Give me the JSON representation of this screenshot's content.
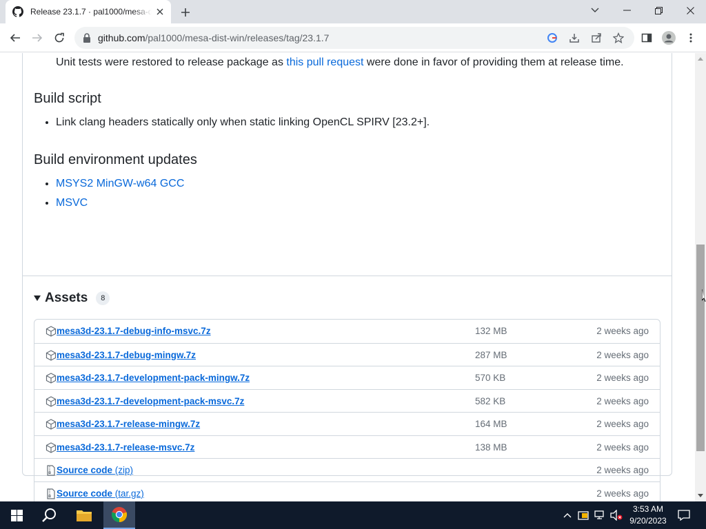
{
  "browser": {
    "tab_title": "Release 23.1.7 · pal1000/mesa-dist-win",
    "url_host": "github.com",
    "url_path": "/pal1000/mesa-dist-win/releases/tag/23.1.7"
  },
  "page": {
    "cutoff_text_before": "Unit tests were restored to release package as",
    "cutoff_link": "this pull request",
    "cutoff_text_after": "were done in favor of providing them at release time.",
    "sections": [
      {
        "title": "Build script",
        "items": [
          {
            "text": "Link clang headers statically only when static linking OpenCL SPIRV [23.2+].",
            "link": false
          }
        ]
      },
      {
        "title": "Build environment updates",
        "items": [
          {
            "text": "MSYS2 MinGW-w64 GCC",
            "link": true
          },
          {
            "text": "MSVC",
            "link": true
          }
        ]
      }
    ],
    "assets": {
      "title": "Assets",
      "count": "8",
      "rows": [
        {
          "name": "mesa3d-23.1.7-debug-info-msvc.7z",
          "ext": "",
          "size": "132 MB",
          "date": "2 weeks ago",
          "icon": "package-icon"
        },
        {
          "name": "mesa3d-23.1.7-debug-mingw.7z",
          "ext": "",
          "size": "287 MB",
          "date": "2 weeks ago",
          "icon": "package-icon"
        },
        {
          "name": "mesa3d-23.1.7-development-pack-mingw.7z",
          "ext": "",
          "size": "570 KB",
          "date": "2 weeks ago",
          "icon": "package-icon"
        },
        {
          "name": "mesa3d-23.1.7-development-pack-msvc.7z",
          "ext": "",
          "size": "582 KB",
          "date": "2 weeks ago",
          "icon": "package-icon"
        },
        {
          "name": "mesa3d-23.1.7-release-mingw.7z",
          "ext": "",
          "size": "164 MB",
          "date": "2 weeks ago",
          "icon": "package-icon"
        },
        {
          "name": "mesa3d-23.1.7-release-msvc.7z",
          "ext": "",
          "size": "138 MB",
          "date": "2 weeks ago",
          "icon": "package-icon"
        },
        {
          "name": "Source code",
          "ext": "(zip)",
          "size": "",
          "date": "2 weeks ago",
          "icon": "file-zip-icon"
        },
        {
          "name": "Source code",
          "ext": "(tar.gz)",
          "size": "",
          "date": "2 weeks ago",
          "icon": "file-zip-icon"
        }
      ]
    }
  },
  "taskbar": {
    "time": "3:53 AM",
    "date": "9/20/2023"
  },
  "colors": {
    "link": "#0969da",
    "text": "#1f2328",
    "muted": "#656d76",
    "border": "#d0d7de",
    "taskbar": "#0f1a2b"
  }
}
